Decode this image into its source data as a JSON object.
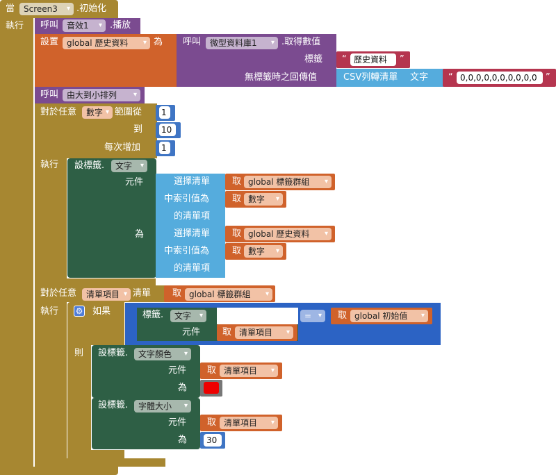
{
  "event": {
    "prefix": "當",
    "component": "Screen3",
    "event_name": ".初始化",
    "do_label": "執行"
  },
  "call_sound": {
    "call": "呼叫",
    "component": "音效1",
    "method": ".播放"
  },
  "set_history": {
    "set": "設置",
    "var": "global 歷史資料",
    "to": "為",
    "call": "呼叫",
    "db_component": "微型資料庫1",
    "method": ".取得數值",
    "tag_label": "標籤",
    "tag_value": "歷史資料",
    "default_label": "無標籤時之回傳值",
    "csv_block": "CSV列轉清單",
    "csv_text_label": "文字",
    "csv_value": "0,0,0,0,0,0,0,0,0,0"
  },
  "call_sort": {
    "call": "呼叫",
    "procedure": "由大到小排列"
  },
  "for_range": {
    "label": "對於任意",
    "var": "數字",
    "range_from": "範圍從",
    "from_value": "1",
    "to_label": "到",
    "to_value": "10",
    "step_label": "每次增加",
    "step_value": "1",
    "do_label": "執行",
    "set_label": "設標籤.",
    "property": "文字",
    "component_label": "元件",
    "to": "為",
    "select_item_1": "選擇清單",
    "select_item_2": "中索引值為",
    "select_item_3": "的清單項",
    "get": "取",
    "list1": "global 標籤群組",
    "index_var": "數字",
    "list2": "global 歷史資料"
  },
  "for_each": {
    "label": "對於任意",
    "var": "清單項目",
    "list_label": "清單",
    "get": "取",
    "list": "global 標籤群組",
    "do_label": "執行",
    "if_label": "如果",
    "then_label": "則",
    "cond_prop_label": "標籤.",
    "cond_prop": "文字",
    "cond_component_label": "元件",
    "cond_item": "清單項目",
    "op": "=",
    "cond_rhs": "global 初始值",
    "set1_label": "設標籤.",
    "set1_prop": "文字顏色",
    "set1_component_label": "元件",
    "set1_item": "清單項目",
    "set1_to": "為",
    "color_value": "#ee0000",
    "set2_label": "設標籤.",
    "set2_prop": "字體大小",
    "set2_component_label": "元件",
    "set2_item": "清單項目",
    "set2_to": "為",
    "size_value": "30"
  }
}
